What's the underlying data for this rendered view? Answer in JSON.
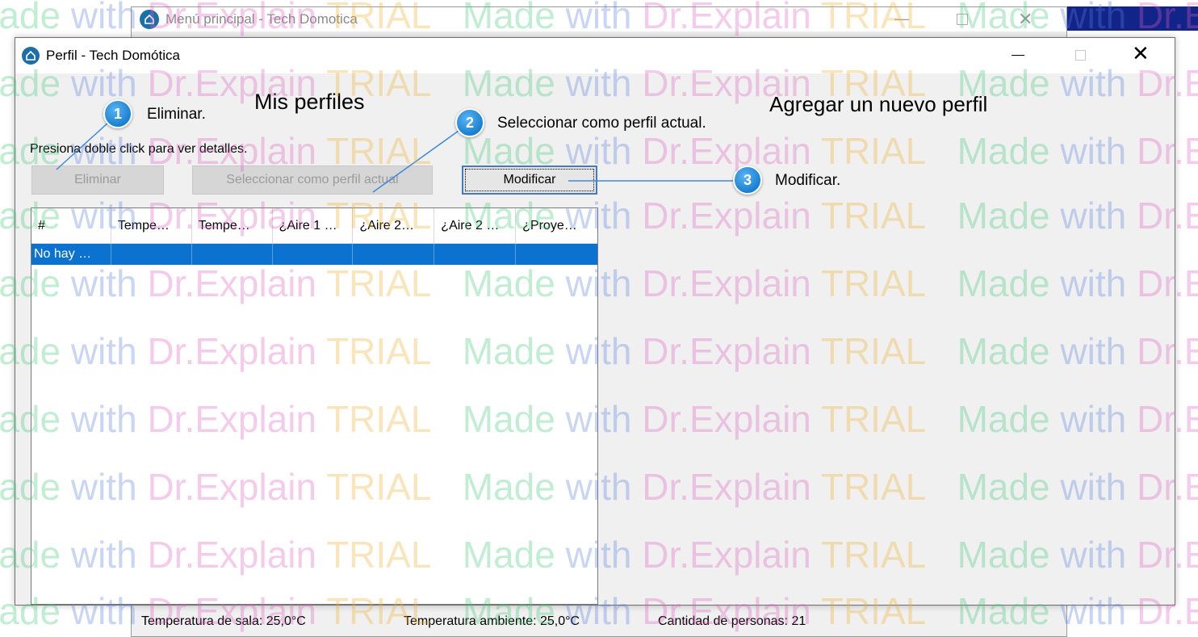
{
  "background_window": {
    "title": "Menú principal - Tech Domotica",
    "status": {
      "room_temp": "Temperatura de sala: 25,0°C",
      "ambient_temp": "Temperatura ambiente: 25,0°C",
      "people_count": "Cantidad de personas: 21"
    }
  },
  "dialog": {
    "title": "Perfil - Tech Domótica",
    "heading_left": "Mis perfiles",
    "heading_right": "Agregar un nuevo perfil",
    "hint": "Presiona doble click para ver detalles.",
    "buttons": {
      "eliminar": "Eliminar",
      "seleccionar": "Seleccionar como perfil actual",
      "modificar": "Modificar"
    },
    "table": {
      "columns": [
        "#",
        "Tempe…",
        "Tempe…",
        "¿Aire 1 …",
        "¿Aire 2…",
        "¿Aire 2 …",
        "¿Proye…"
      ],
      "rows": [
        [
          "No hay …",
          "",
          "",
          "",
          "",
          "",
          ""
        ]
      ]
    }
  },
  "callouts": [
    {
      "number": "1",
      "text": "Eliminar."
    },
    {
      "number": "2",
      "text": "Seleccionar como perfil actual."
    },
    {
      "number": "3",
      "text": "Modificar."
    }
  ],
  "watermark": {
    "made": "Made",
    "with": "with",
    "dr": "Dr.Explain",
    "trial": "TRIAL"
  },
  "colors": {
    "selection": "#0b73cf",
    "callout": "#1a7fd0",
    "focus_border": "#4a7ab5"
  }
}
